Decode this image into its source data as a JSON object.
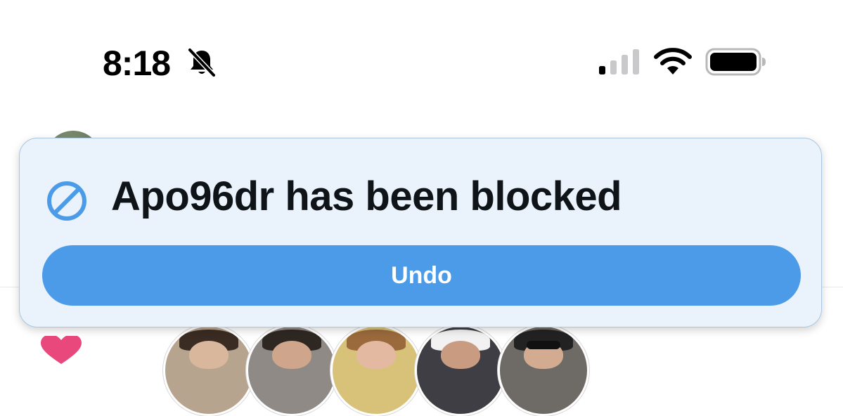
{
  "status_bar": {
    "time": "8:18",
    "icons": [
      "bell-slash-icon",
      "cellular-signal-icon",
      "wifi-icon",
      "battery-icon"
    ]
  },
  "toast": {
    "icon": "block-icon",
    "message": "Apo96dr has been blocked",
    "undo_label": "Undo"
  },
  "colors": {
    "toast_background": "#eaf3fb",
    "toast_border": "#a9c7e2",
    "accent": "#4b9be8",
    "text_primary": "#0f1419",
    "heart": "#e8487b"
  },
  "background_content": {
    "icons": [
      "avatar",
      "heart-icon"
    ],
    "story_avatar_count": 5
  }
}
